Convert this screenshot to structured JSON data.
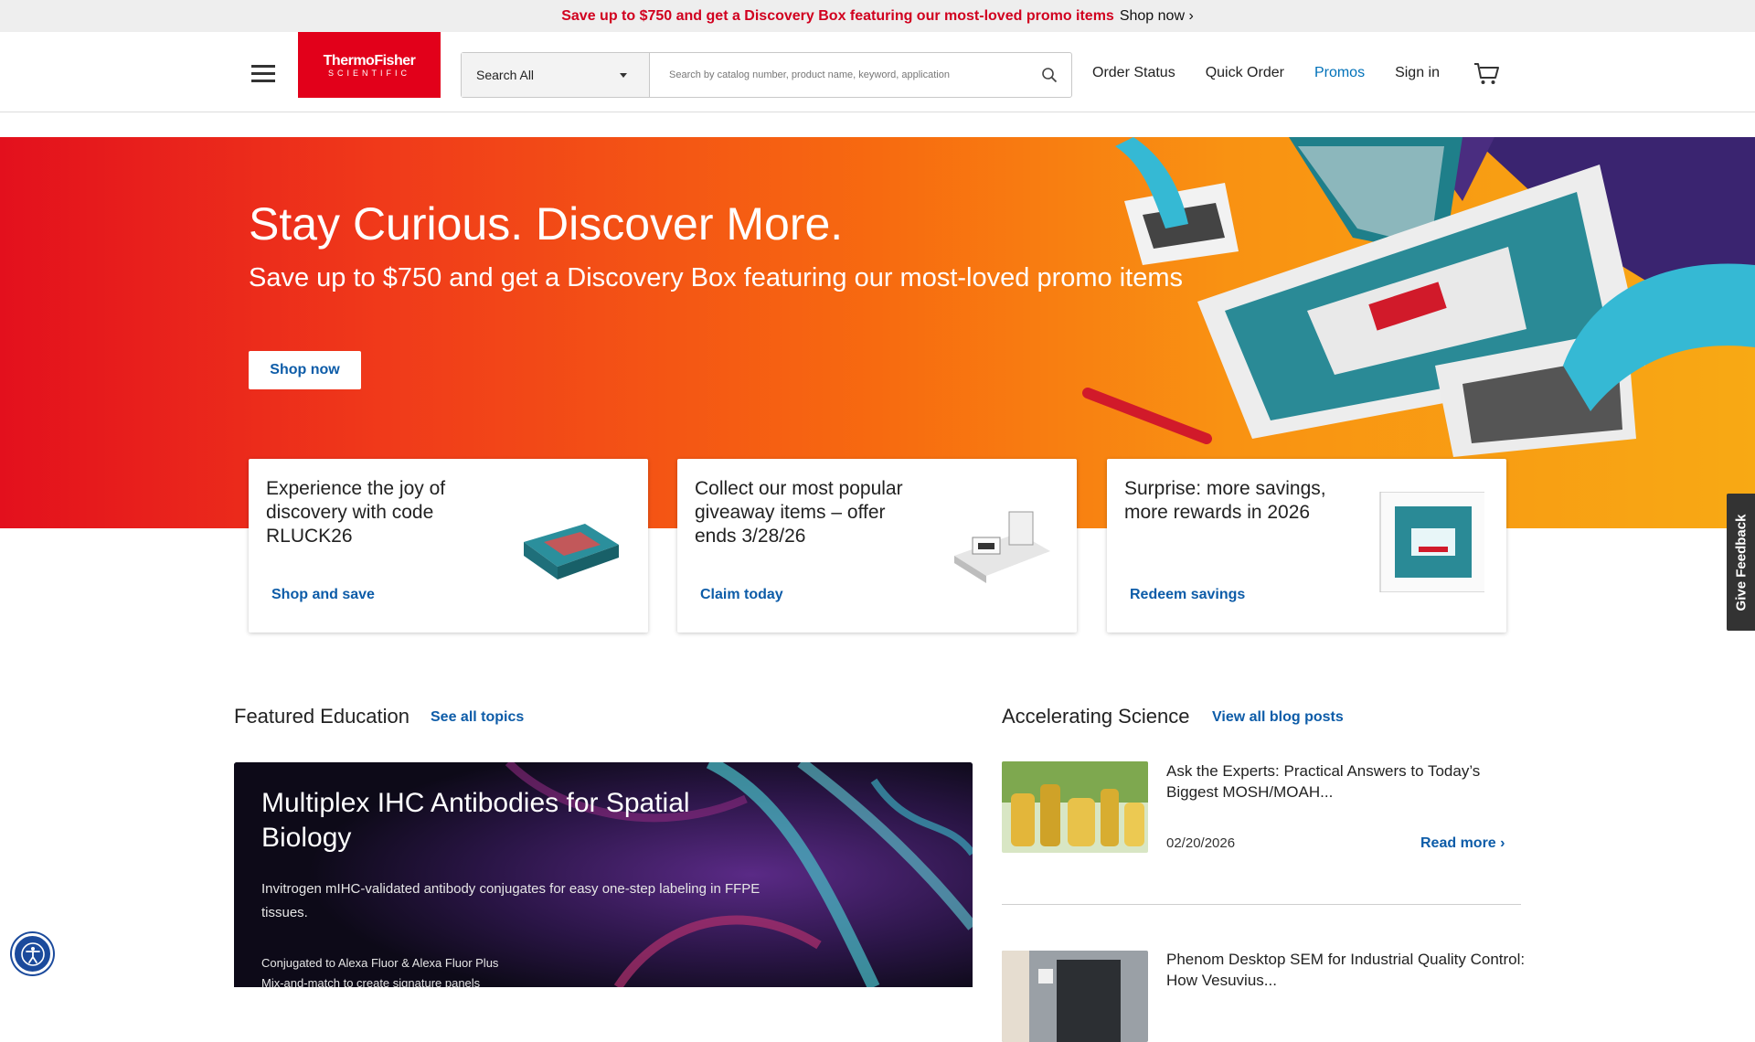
{
  "promo_bar": {
    "text": "Save up to $750 and get a Discovery Box featuring our most-loved promo items",
    "link": "Shop now ›"
  },
  "header": {
    "logo_line1": "ThermoFisher",
    "logo_line2": "SCIENTIFIC",
    "search": {
      "category": "Search All",
      "placeholder": "Search by catalog number, product name, keyword, application"
    },
    "nav": [
      "Order Status",
      "Quick Order",
      "Promos",
      "Sign in"
    ]
  },
  "hero": {
    "title": "Stay Curious. Discover More.",
    "subtitle": "Save up to $750 and get a Discovery Box featuring our most-loved promo items",
    "button": "Shop now"
  },
  "cards": [
    {
      "text": "Experience the joy of discovery with code RLUCK26",
      "link": "Shop and save"
    },
    {
      "text": "Collect our most popular giveaway items – offer ends 3/28/26",
      "link": "Claim today"
    },
    {
      "text": "Surprise: more savings, more rewards in 2026",
      "link": "Redeem savings"
    }
  ],
  "feedback": "Give Feedback",
  "education": {
    "heading": "Featured Education",
    "link": "See all topics",
    "feature": {
      "title": "Multiplex IHC Antibodies for Spatial Biology",
      "description": "Invitrogen mIHC-validated antibody conjugates for easy one-step labeling in FFPE tissues.",
      "bullets": [
        "Conjugated to Alexa Fluor & Alexa Fluor Plus",
        "Mix-and-match to create signature panels"
      ]
    }
  },
  "blog": {
    "heading": "Accelerating Science",
    "link": "View all blog posts",
    "posts": [
      {
        "title": "Ask the Experts: Practical Answers to Today’s Biggest MOSH/MOAH...",
        "date": "02/20/2026",
        "read_more": "Read more ›"
      },
      {
        "title": "Phenom Desktop SEM for Industrial Quality Control: How Vesuvius..."
      }
    ]
  },
  "colors": {
    "brand_red": "#e2001a",
    "link_blue": "#0d5ca8",
    "promo_red": "#d1001f"
  },
  "icons": [
    "hamburger-icon",
    "search-icon",
    "cart-icon",
    "accessibility-icon"
  ]
}
